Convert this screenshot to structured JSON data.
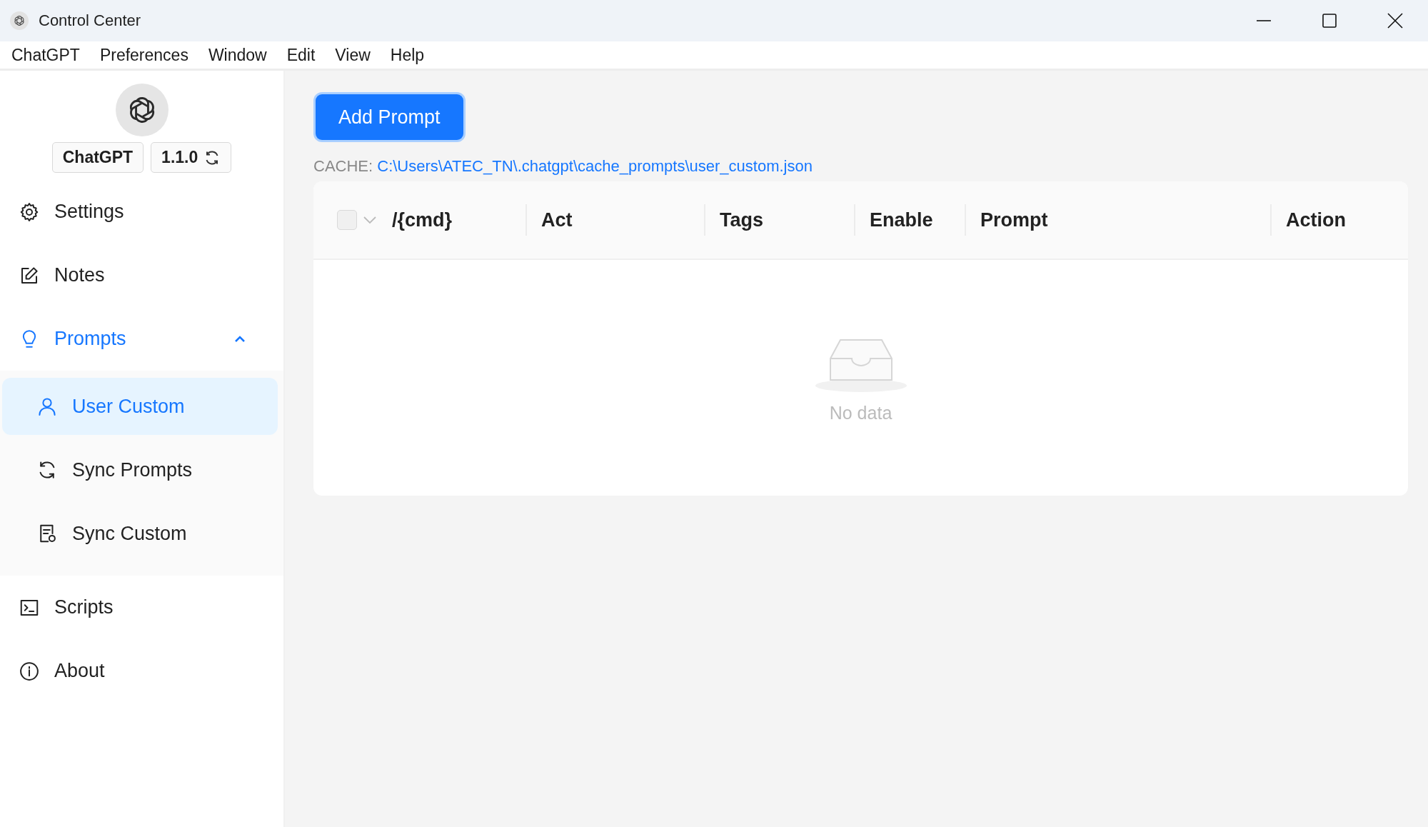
{
  "window": {
    "title": "Control Center"
  },
  "menu": [
    "ChatGPT",
    "Preferences",
    "Window",
    "Edit",
    "View",
    "Help"
  ],
  "app": {
    "name": "ChatGPT",
    "version": "1.1.0"
  },
  "sidebar": {
    "items": [
      {
        "label": "Settings",
        "selected": false
      },
      {
        "label": "Notes",
        "selected": false
      },
      {
        "label": "Prompts",
        "selected": false,
        "expanded": true,
        "children": [
          {
            "label": "User Custom",
            "selected": true
          },
          {
            "label": "Sync Prompts",
            "selected": false
          },
          {
            "label": "Sync Custom",
            "selected": false
          }
        ]
      },
      {
        "label": "Scripts",
        "selected": false
      },
      {
        "label": "About",
        "selected": false
      }
    ]
  },
  "add_button": "Add Prompt",
  "cache": {
    "label": "CACHE:",
    "path": "C:\\Users\\ATEC_TN\\.chatgpt\\cache_prompts\\user_custom.json"
  },
  "table": {
    "select_all": {
      "checked": false
    },
    "columns": [
      "/{cmd}",
      "Act",
      "Tags",
      "Enable",
      "Prompt",
      "Action"
    ],
    "empty_text": "No data"
  }
}
